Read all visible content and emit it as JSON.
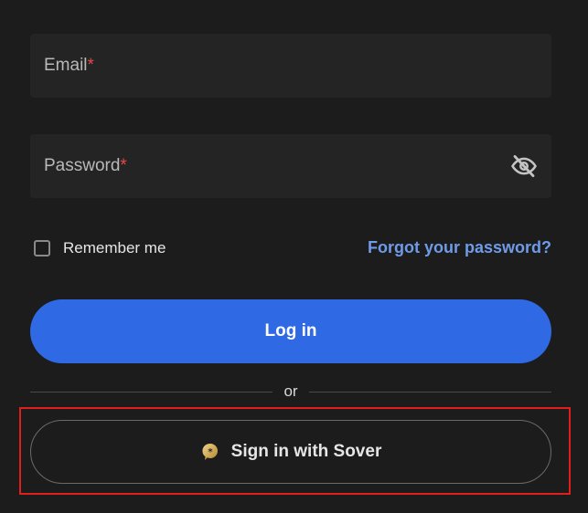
{
  "form": {
    "email": {
      "label": "Email",
      "required_mark": "*",
      "value": ""
    },
    "password": {
      "label": "Password",
      "required_mark": "*",
      "value": "",
      "toggle_icon": "eye-off-icon"
    },
    "remember": {
      "label": "Remember me",
      "checked": false
    },
    "forgot_link": "Forgot your password?",
    "login_button": "Log in",
    "divider_text": "or",
    "sover_button": {
      "label": "Sign in with Sover",
      "icon": "sover-logo-icon"
    }
  },
  "colors": {
    "background": "#1c1c1c",
    "field_background": "#242424",
    "primary": "#2f6ae4",
    "link": "#6f9be8",
    "required": "#e5484d",
    "highlight_border": "#e01e1e"
  }
}
